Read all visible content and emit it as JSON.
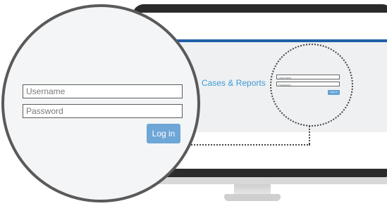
{
  "screen": {
    "heading": "Cases & Reports",
    "mini_form": {
      "username_placeholder": "Username",
      "password_placeholder": "Password",
      "login_label": "Log in"
    }
  },
  "magnifier": {
    "username_placeholder": "Username",
    "password_placeholder": "Password",
    "login_label": "Log in"
  },
  "colors": {
    "accent_blue": "#1f5fa8",
    "heading_blue": "#3f9ad6",
    "button_blue": "#6ea6d6",
    "bezel": "#2b2b2b"
  }
}
